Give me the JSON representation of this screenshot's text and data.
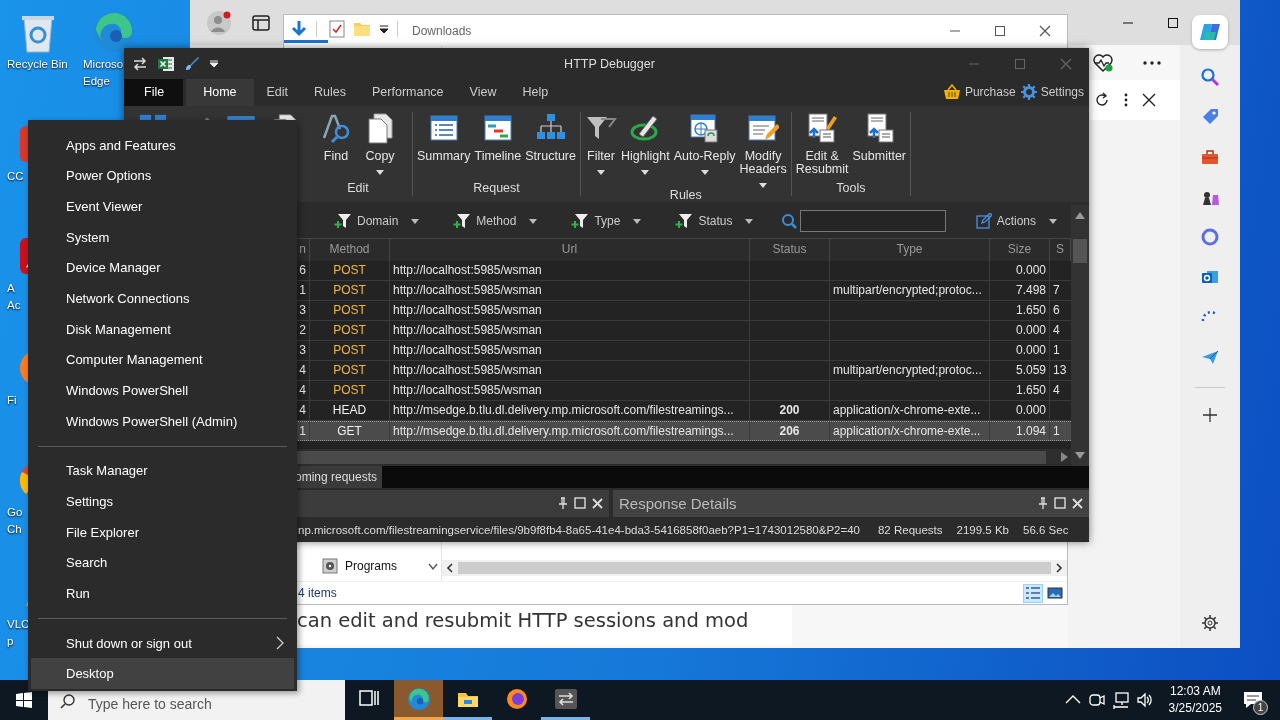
{
  "desktop_icons": [
    {
      "kind": "recycle",
      "label": "Recycle Bin"
    },
    {
      "kind": "cleaner",
      "label": "CC"
    },
    {
      "kind": "reader",
      "label": "A\nAc"
    },
    {
      "kind": "firefox",
      "label": "Fi"
    },
    {
      "kind": "chrome",
      "label": "Go\nCh"
    },
    {
      "kind": "vlc",
      "label": "VLC\np"
    },
    {
      "kind": "edge",
      "label": "Microso\nEdge"
    }
  ],
  "browser": {
    "page_text": "can edit and resubmit HTTP sessions and mod"
  },
  "explorer": {
    "title": "Downloads",
    "nav_items": [
      {
        "kind": "programs",
        "label": "Programs"
      }
    ],
    "status": "4 items",
    "views": [
      {
        "kind": "details",
        "selected": true
      },
      {
        "kind": "tiles",
        "selected": false
      }
    ]
  },
  "debugger": {
    "title": "HTTP Debugger",
    "tabs": [
      {
        "kind": "menu",
        "label": "File",
        "selected": false
      },
      {
        "kind": "tab",
        "label": "Home",
        "selected": true
      },
      {
        "kind": "tab",
        "label": "Edit",
        "selected": false
      },
      {
        "kind": "tab",
        "label": "Rules",
        "selected": false
      },
      {
        "kind": "tab",
        "label": "Performance",
        "selected": false
      },
      {
        "kind": "tab",
        "label": "View",
        "selected": false
      },
      {
        "kind": "tab",
        "label": "Help",
        "selected": false
      }
    ],
    "links": [
      {
        "kind": "purchase",
        "label": "Purchase"
      },
      {
        "kind": "settings",
        "label": "Settings"
      }
    ],
    "ribbon_groups": [
      {
        "label": "Edit",
        "buttons": [
          {
            "label": "Find",
            "dropdown": false
          },
          {
            "label": "Copy",
            "dropdown": true
          }
        ]
      },
      {
        "label": "Request",
        "buttons": [
          {
            "label": "Summary",
            "dropdown": false
          },
          {
            "label": "Timeline",
            "dropdown": false
          },
          {
            "label": "Structure",
            "dropdown": false
          }
        ]
      },
      {
        "label": "Rules",
        "buttons": [
          {
            "label": "Filter",
            "dropdown": true
          },
          {
            "label": "Highlight",
            "dropdown": true
          },
          {
            "label": "Auto-Reply",
            "dropdown": true
          },
          {
            "label": "Modify\nHeaders",
            "dropdown": true
          }
        ]
      },
      {
        "label": "Tools",
        "buttons": [
          {
            "label": "Edit &\nResubmit",
            "dropdown": false
          },
          {
            "label": "Submitter",
            "dropdown": false
          }
        ]
      }
    ],
    "filters": [
      {
        "label": "Domain"
      },
      {
        "label": "Method"
      },
      {
        "label": "Type"
      },
      {
        "label": "Status"
      }
    ],
    "actions": {
      "label": "Actions"
    },
    "table": {
      "columns": [
        "n",
        "Method",
        "Url",
        "Status",
        "Type",
        "Size",
        "S"
      ],
      "rows": [
        {
          "cells": [
            "6",
            "POST",
            "http://localhost:5985/wsman",
            "",
            "",
            "0.000",
            ""
          ],
          "color": "#f2b642",
          "selected": false
        },
        {
          "cells": [
            "1",
            "POST",
            "http://localhost:5985/wsman",
            "",
            "multipart/encrypted;protoc...",
            "7.498",
            "7"
          ],
          "color": "#f2b642",
          "selected": false
        },
        {
          "cells": [
            "3",
            "POST",
            "http://localhost:5985/wsman",
            "",
            "",
            "1.650",
            "6"
          ],
          "color": "#f2b642",
          "selected": false
        },
        {
          "cells": [
            "2",
            "POST",
            "http://localhost:5985/wsman",
            "",
            "",
            "0.000",
            "4"
          ],
          "color": "#f2b642",
          "selected": false
        },
        {
          "cells": [
            "3",
            "POST",
            "http://localhost:5985/wsman",
            "",
            "",
            "0.000",
            "1"
          ],
          "color": "#f2b642",
          "selected": false
        },
        {
          "cells": [
            "4",
            "POST",
            "http://localhost:5985/wsman",
            "",
            "multipart/encrypted;protoc...",
            "5.059",
            "13"
          ],
          "color": "#f2b642",
          "selected": false
        },
        {
          "cells": [
            "4",
            "POST",
            "http://localhost:5985/wsman",
            "",
            "",
            "1.650",
            "4"
          ],
          "color": "#f2b642",
          "selected": false
        },
        {
          "cells": [
            "4",
            "HEAD",
            "http://msedge.b.tlu.dl.delivery.mp.microsoft.com/filestreamings...",
            "200",
            "application/x-chrome-exte...",
            "0.000",
            ""
          ],
          "selected": false
        },
        {
          "cells": [
            "1",
            "GET",
            "http://msedge.b.tlu.dl.delivery.mp.microsoft.com/filestreamings...",
            "206",
            "application/x-chrome-exte...",
            "1.094",
            "1"
          ],
          "selected": true
        }
      ]
    },
    "bottom_tabs": [
      {
        "label": "oming requests",
        "selected": true
      }
    ],
    "response_panel": {
      "title": "Response Details"
    },
    "status_bar": [
      "np.microsoft.com/filestreamingservice/files/9b9f8fb4-8a65-41e4-bda3-5416858f0aeb?P1=1743012580&P2=40",
      "82 Requests",
      "2199.5 Kb",
      "56.6 Sec"
    ]
  },
  "menu": {
    "groups": [
      {
        "items": [
          {
            "label": "Apps and Features",
            "selected": false,
            "submenu": false
          },
          {
            "label": "Power Options",
            "selected": false,
            "submenu": false
          },
          {
            "label": "Event Viewer",
            "selected": false,
            "submenu": false
          },
          {
            "label": "System",
            "selected": false,
            "submenu": false
          },
          {
            "label": "Device Manager",
            "selected": false,
            "submenu": false
          },
          {
            "label": "Network Connections",
            "selected": false,
            "submenu": false
          },
          {
            "label": "Disk Management",
            "selected": false,
            "submenu": false
          },
          {
            "label": "Computer Management",
            "selected": false,
            "submenu": false
          },
          {
            "label": "Windows PowerShell",
            "selected": false,
            "submenu": false
          },
          {
            "label": "Windows PowerShell (Admin)",
            "selected": false,
            "submenu": false
          }
        ]
      },
      {
        "items": [
          {
            "label": "Task Manager",
            "selected": false,
            "submenu": false
          },
          {
            "label": "Settings",
            "selected": false,
            "submenu": false
          },
          {
            "label": "File Explorer",
            "selected": false,
            "submenu": false
          },
          {
            "label": "Search",
            "selected": false,
            "submenu": false
          },
          {
            "label": "Run",
            "selected": false,
            "submenu": false
          }
        ]
      },
      {
        "items": [
          {
            "label": "Shut down or sign out",
            "selected": false,
            "submenu": true
          },
          {
            "label": "Desktop",
            "selected": true,
            "submenu": false
          }
        ]
      }
    ]
  },
  "taskbar": {
    "search": {
      "placeholder": "Type here to search"
    },
    "apps": [
      {
        "kind": "taskview",
        "selected": false,
        "running": false
      },
      {
        "kind": "edge",
        "selected": true,
        "running": true
      },
      {
        "kind": "explorer",
        "selected": false,
        "running": true
      },
      {
        "kind": "firefox",
        "selected": false,
        "running": false
      },
      {
        "kind": "debugger",
        "selected": false,
        "running": true
      }
    ],
    "time": "12:03 AM",
    "date": "3/25/2025",
    "notifications": "1"
  }
}
